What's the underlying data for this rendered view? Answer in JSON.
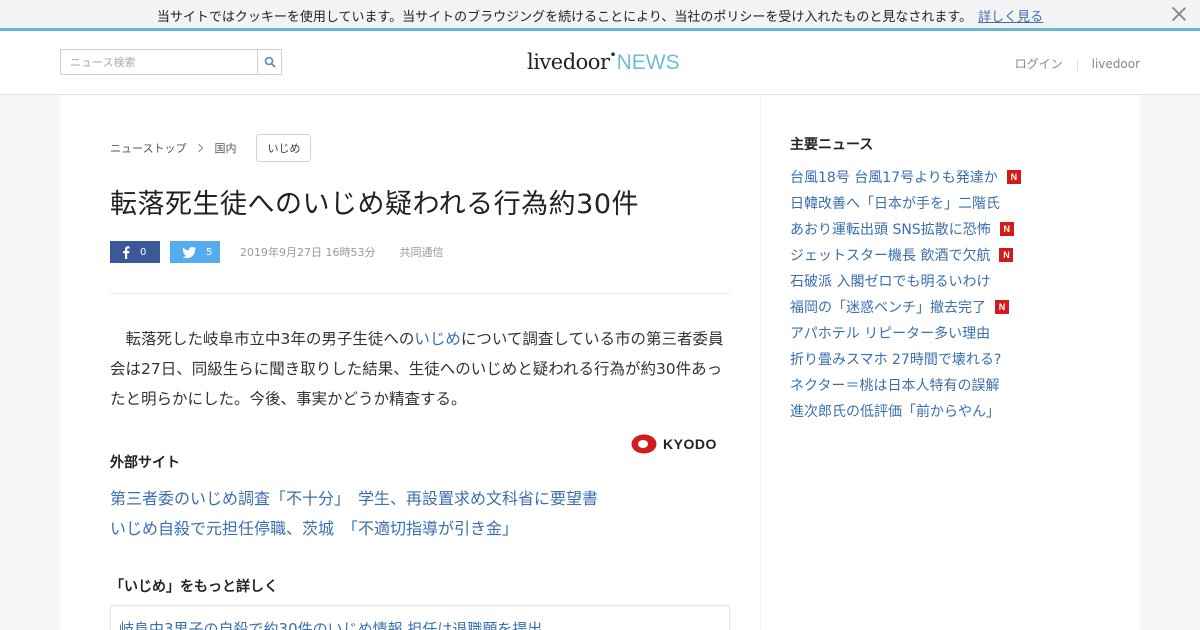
{
  "cookie": {
    "text": "当サイトではクッキーを使用しています。当サイトのブラウジングを続けることにより、当社のポリシーを受け入れたものと見なされます。",
    "link": "詳しく見る"
  },
  "header": {
    "search_placeholder": "ニュース検索",
    "logo_main": "livedoor",
    "logo_dot": "•",
    "logo_news": "NEWS",
    "login": "ログイン",
    "livedoor_link": "livedoor"
  },
  "breadcrumb": {
    "top": "ニューストップ",
    "category": "国内",
    "tag": "いじめ"
  },
  "article": {
    "title": "転落死生徒へのいじめ疑われる行為約30件",
    "fb_count": "0",
    "tw_count": "5",
    "date": "2019年9月27日 16時53分",
    "source": "共同通信",
    "body_pre": "　転落死した岐阜市立中3年の男子生徒への",
    "body_link": "いじめ",
    "body_post": "について調査している市の第三者委員会は27日、同級生らに聞き取りした結果、生徒へのいじめと疑われる行為が約30件あったと明らかにした。今後、事実かどうか精査する。",
    "provider_logo": "KYODO"
  },
  "external": {
    "heading": "外部サイト",
    "links": [
      "第三者委のいじめ調査「不十分」　学生、再設置求め文科省に要望書",
      "いじめ自殺で元担任停職、茨城　「不適切指導が引き金」"
    ]
  },
  "more": {
    "heading": "「いじめ」をもっと詳しく",
    "first_link": "岐阜中3男子の自殺で約30件のいじめ情報 担任は退職願を提出"
  },
  "sidebar": {
    "heading": "主要ニュース",
    "badge_label": "N",
    "badge_color": "#d31b1b",
    "items": [
      {
        "label": "台風18号 台風17号よりも発達か",
        "new": true
      },
      {
        "label": "日韓改善へ「日本が手を」二階氏",
        "new": false
      },
      {
        "label": "あおり運転出頭 SNS拡散に恐怖",
        "new": true
      },
      {
        "label": "ジェットスター機長 飲酒で欠航",
        "new": true
      },
      {
        "label": "石破派 入閣ゼロでも明るいわけ",
        "new": false
      },
      {
        "label": "福岡の「迷惑ベンチ」撤去完了",
        "new": true
      },
      {
        "label": "アパホテル リピーター多い理由",
        "new": false
      },
      {
        "label": "折り畳みスマホ 27時間で壊れる?",
        "new": false
      },
      {
        "label": "ネクター＝桃は日本人特有の誤解",
        "new": false
      },
      {
        "label": "進次郎氏の低評価「前からやん」",
        "new": false
      }
    ]
  },
  "colors": {
    "accent": "#69b8cc",
    "link": "#3a6fb0",
    "facebook": "#3b5998",
    "twitter": "#55acee"
  }
}
